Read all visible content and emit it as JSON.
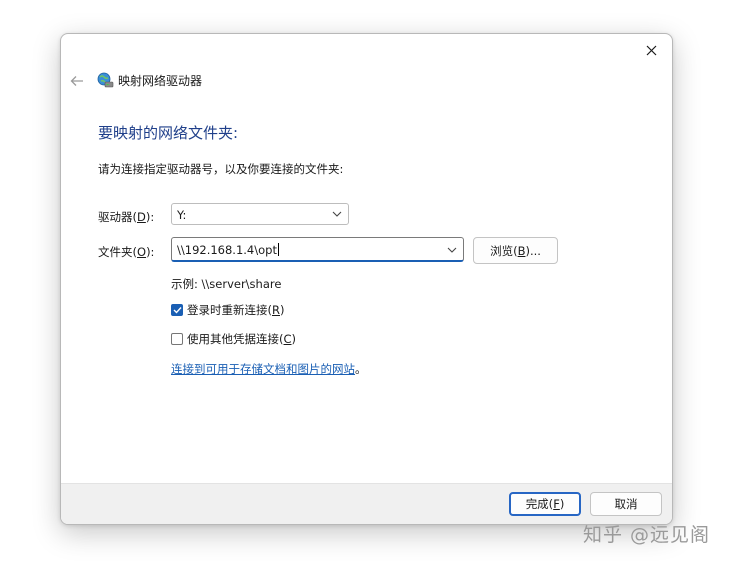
{
  "window": {
    "title": "映射网络驱动器"
  },
  "main": {
    "heading": "要映射的网络文件夹:",
    "instruction": "请为连接指定驱动器号，以及你要连接的文件夹:",
    "drive": {
      "label": "驱动器(",
      "accel": "D",
      "label_end": "):",
      "value": "Y:"
    },
    "folder": {
      "label": "文件夹(",
      "accel": "O",
      "label_end": "):",
      "value": "\\\\192.168.1.4\\opt"
    },
    "browse": {
      "label": "浏览(",
      "accel": "B",
      "label_end": ")..."
    },
    "example": "示例: \\\\server\\share",
    "reconnect": {
      "label": "登录时重新连接(",
      "accel": "R",
      "label_end": ")",
      "checked": true
    },
    "other_credentials": {
      "label": "使用其他凭据连接(",
      "accel": "C",
      "label_end": ")",
      "checked": false
    },
    "link": {
      "text": "连接到可用于存储文档和图片的网站",
      "suffix": "。"
    }
  },
  "footer": {
    "finish": {
      "label": "完成(",
      "accel": "F",
      "label_end": ")"
    },
    "cancel": "取消"
  },
  "watermark": "知乎 @远见阁",
  "colors": {
    "accent": "#1a5fb4",
    "heading": "#1f3f8a",
    "footer_bg": "#f0f0f0"
  },
  "icons": [
    "close-icon",
    "back-arrow-icon",
    "network-drive-icon",
    "chevron-down-icon",
    "checkmark-icon"
  ]
}
